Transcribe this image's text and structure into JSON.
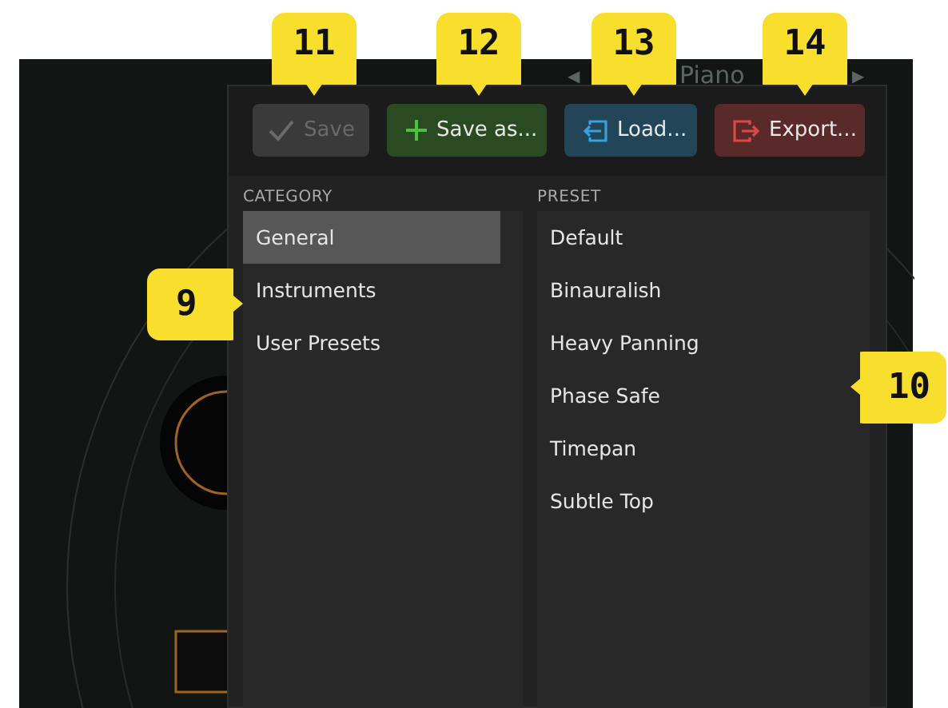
{
  "background": {
    "prev_arrow": "◀",
    "preset_name": "Piano",
    "next_arrow": "▶"
  },
  "preset_panel": {
    "buttons": [
      {
        "kind": "save",
        "label": "Save",
        "disabled": true
      },
      {
        "kind": "save_as",
        "label": "Save as...",
        "disabled": false
      },
      {
        "kind": "load",
        "label": "Load...",
        "disabled": false
      },
      {
        "kind": "export",
        "label": "Export...",
        "disabled": false
      }
    ],
    "category": {
      "heading": "CATEGORY",
      "items": [
        {
          "label": "General",
          "selected": true
        },
        {
          "label": "Instruments",
          "selected": false
        },
        {
          "label": "User Presets",
          "selected": false
        }
      ]
    },
    "preset": {
      "heading": "PRESET",
      "items": [
        {
          "label": "Default",
          "selected": false
        },
        {
          "label": "Binauralish",
          "selected": false
        },
        {
          "label": "Heavy Panning",
          "selected": false
        },
        {
          "label": "Phase Safe",
          "selected": false
        },
        {
          "label": "Timepan",
          "selected": false
        },
        {
          "label": "Subtle Top",
          "selected": false
        }
      ]
    }
  },
  "callouts": [
    {
      "label": "11",
      "kind": "down"
    },
    {
      "label": "12",
      "kind": "down"
    },
    {
      "label": "13",
      "kind": "down"
    },
    {
      "label": "14",
      "kind": "down"
    },
    {
      "label": "9",
      "kind": "right"
    },
    {
      "label": "10",
      "kind": "left"
    }
  ]
}
